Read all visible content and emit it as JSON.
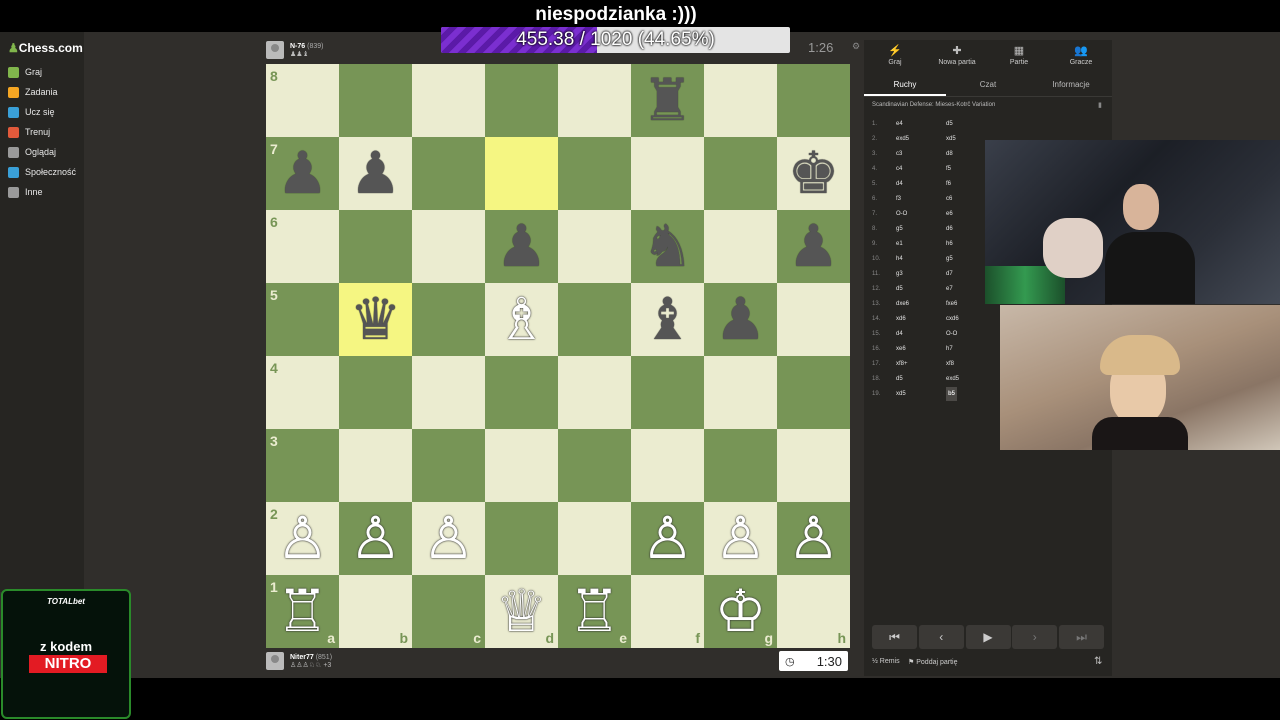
{
  "overlay": {
    "title": "niespodzianka :)))",
    "goal_text": "455.38 / 1020 (44.65%)",
    "goal_fraction": 0.4465
  },
  "sidebar": {
    "logo": "Chess.com",
    "items": [
      {
        "label": "Graj",
        "icon": "play-icon",
        "color": "#81b64c"
      },
      {
        "label": "Zadania",
        "icon": "puzzle-icon",
        "color": "#f5a623"
      },
      {
        "label": "Ucz się",
        "icon": "learn-icon",
        "color": "#3aa0d8"
      },
      {
        "label": "Trenuj",
        "icon": "train-icon",
        "color": "#e25a3b"
      },
      {
        "label": "Oglądaj",
        "icon": "watch-icon",
        "color": "#9a9a9a"
      },
      {
        "label": "Społeczność",
        "icon": "community-icon",
        "color": "#3aa0d8"
      },
      {
        "label": "Inne",
        "icon": "more-icon",
        "color": "#9a9a9a"
      }
    ]
  },
  "players": {
    "top": {
      "name": "N-76",
      "rating": "(839)",
      "clock": "1:26"
    },
    "bottom": {
      "name": "Niter77",
      "rating": "(851)",
      "extra": "+3",
      "clock": "1:30"
    }
  },
  "board": {
    "ranks": [
      "8",
      "7",
      "6",
      "5",
      "4",
      "3",
      "2",
      "1"
    ],
    "files": [
      "a",
      "b",
      "c",
      "d",
      "e",
      "f",
      "g",
      "h"
    ],
    "highlights": [
      "d7",
      "b5"
    ],
    "pieces": {
      "f8": "♜",
      "a7": "♟",
      "b7": "♟",
      "h7": "♚",
      "d6": "♟",
      "f6": "♞",
      "h6": "♟",
      "b5": "♛",
      "d5": "♗",
      "f5": "♝",
      "g5": "♟",
      "a2": "♙",
      "b2": "♙",
      "c2": "♙",
      "f2": "♙",
      "g2": "♙",
      "h2": "♙",
      "a1": "♖",
      "d1": "♕",
      "e1": "♖",
      "g1": "♔"
    }
  },
  "panel": {
    "tabs": [
      "Graj",
      "Nowa partia",
      "Partie",
      "Gracze"
    ],
    "subtabs": [
      "Ruchy",
      "Czat",
      "Informacje"
    ],
    "opening": "Scandinavian Defense: Mieses-Kotrč Variation",
    "moves": [
      [
        "1.",
        "e4",
        "d5"
      ],
      [
        "2.",
        "exd5",
        "xd5"
      ],
      [
        "3.",
        "c3",
        "d8"
      ],
      [
        "4.",
        "c4",
        "f5"
      ],
      [
        "5.",
        "d4",
        "f6"
      ],
      [
        "6.",
        "f3",
        "c6"
      ],
      [
        "7.",
        "O-O",
        "e6"
      ],
      [
        "8.",
        "g5",
        "d6"
      ],
      [
        "9.",
        "e1",
        "h6"
      ],
      [
        "10.",
        "h4",
        "g5"
      ],
      [
        "11.",
        "g3",
        "d7"
      ],
      [
        "12.",
        "d5",
        "e7"
      ],
      [
        "13.",
        "dxe6",
        "fxe6"
      ],
      [
        "14.",
        "xd6",
        "cxd6"
      ],
      [
        "15.",
        "d4",
        "O-O"
      ],
      [
        "16.",
        "xe6",
        "h7"
      ],
      [
        "17.",
        "xf8+",
        "xf8"
      ],
      [
        "18.",
        "d5",
        "exd5"
      ],
      [
        "19.",
        "xd5",
        "b5"
      ]
    ],
    "remis": "½ Remis",
    "resign": "Poddaj partię"
  },
  "promo": {
    "brand": "TOTALbet",
    "line1": "z kodem",
    "code": "NITRO"
  }
}
